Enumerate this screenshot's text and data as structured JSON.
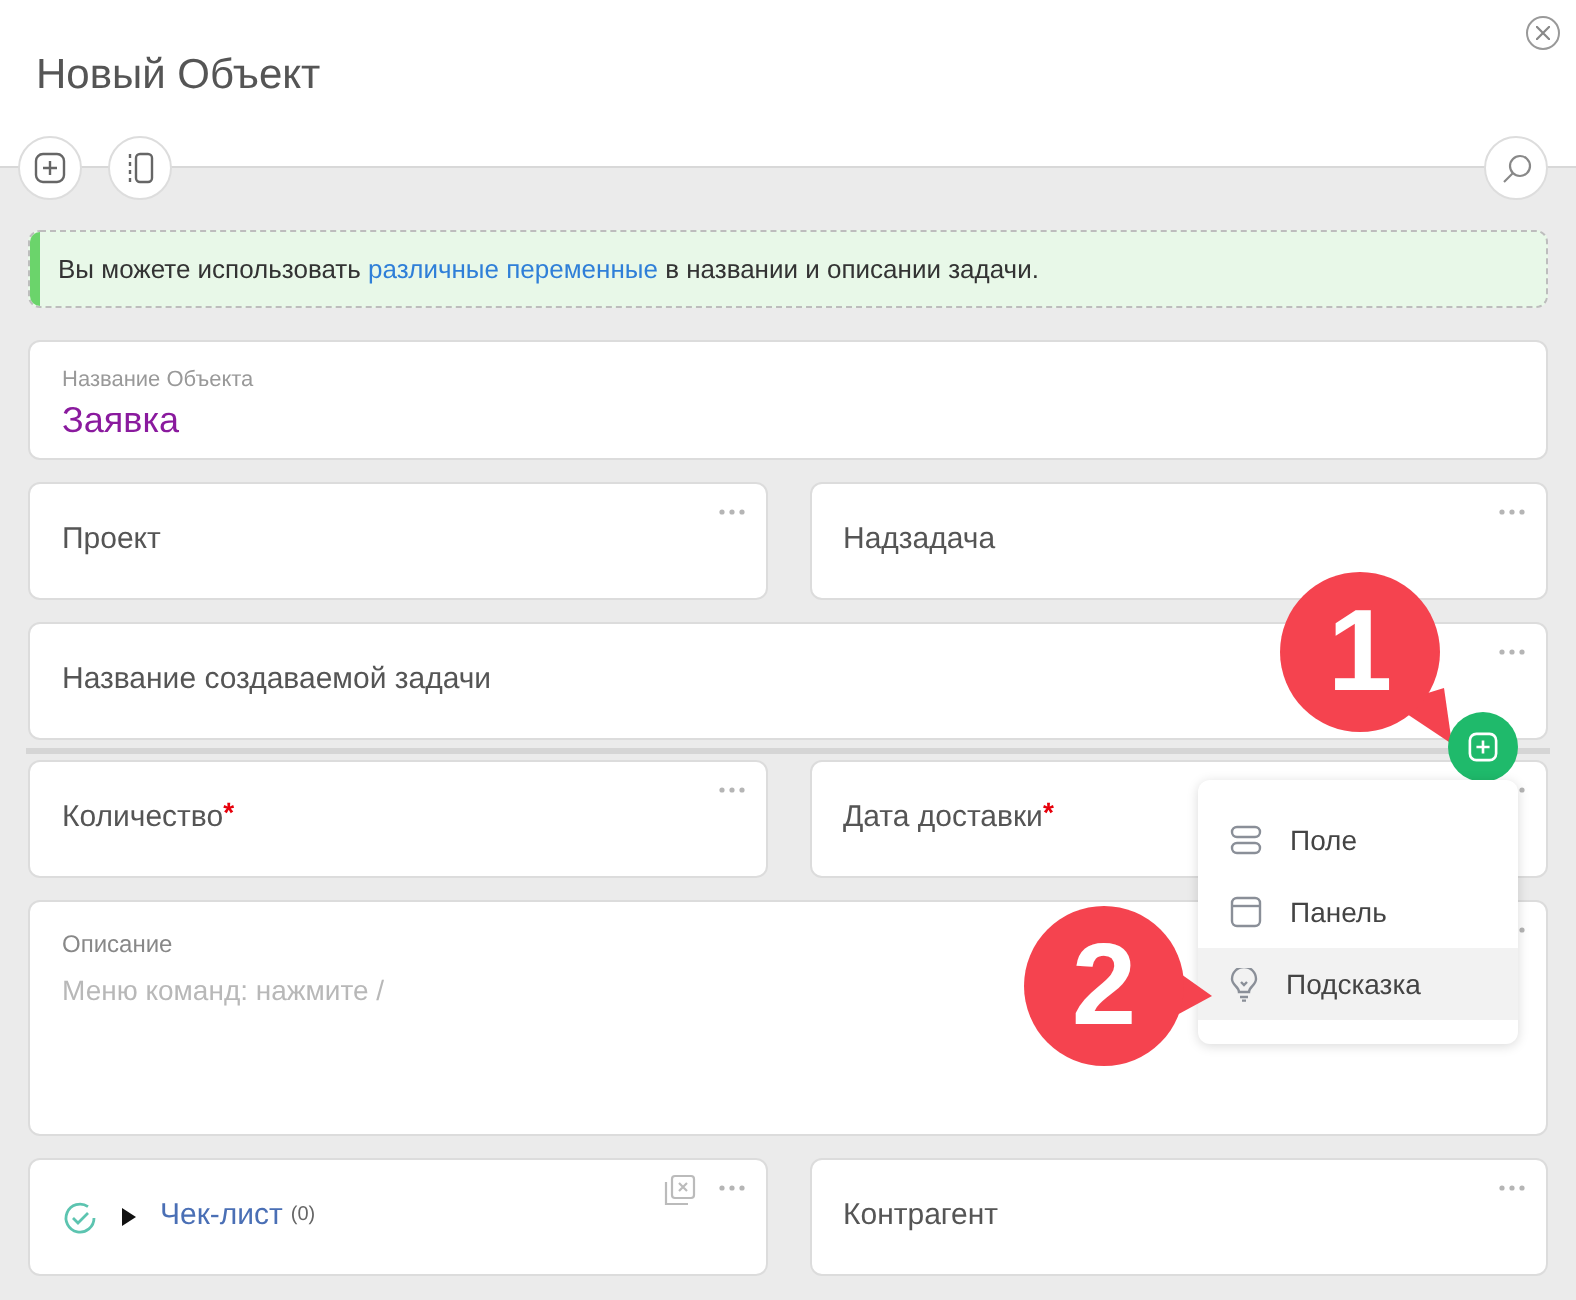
{
  "window": {
    "title": "Новый Объект"
  },
  "notice": {
    "before": "Вы можете использовать",
    "link": "различные переменные",
    "after": "в названии и описании задачи."
  },
  "object_name": {
    "label": "Название Объекта",
    "value": "Заявка"
  },
  "rows": [
    [
      {
        "kind": "field",
        "label": "Проект"
      },
      {
        "kind": "field",
        "label": "Надзадача"
      }
    ],
    [
      {
        "kind": "field",
        "label": "Название создаваемой задачи"
      }
    ],
    [
      {
        "kind": "field",
        "label": "Количество",
        "mark": "*"
      },
      {
        "kind": "field",
        "label": "Дата доставки",
        "mark": "*"
      }
    ],
    [
      {
        "kind": "textarea",
        "label": "Описание",
        "placeholder": "Меню команд: нажмите /"
      }
    ],
    [
      {
        "kind": "checklist",
        "label": "Чек-лист",
        "count": "(0)"
      },
      {
        "kind": "field",
        "label": "Контрагент"
      }
    ]
  ],
  "add_menu": {
    "items": [
      {
        "label": "Поле",
        "kind": "field",
        "selected": false
      },
      {
        "label": "Панель",
        "kind": "panel",
        "selected": false
      },
      {
        "label": "Подсказка",
        "kind": "hint",
        "selected": true
      }
    ]
  },
  "callouts": [
    {
      "number": "1"
    },
    {
      "number": "2"
    }
  ]
}
